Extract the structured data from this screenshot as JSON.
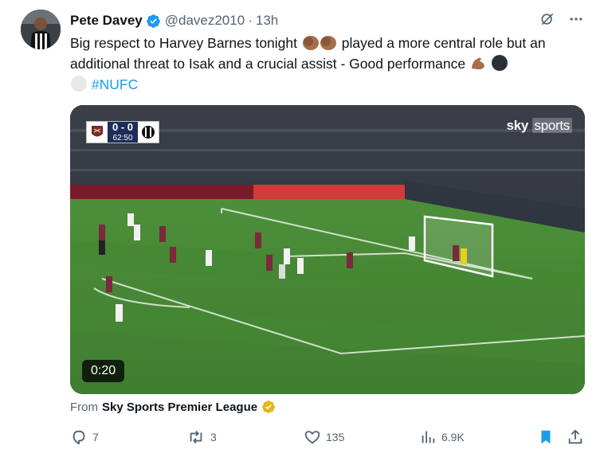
{
  "tweet": {
    "author_name": "Pete Davey",
    "author_handle": "@davez2010",
    "separator": "·",
    "time": "13h",
    "text_main": "Big respect to Harvey Barnes tonight",
    "text_mid": "played a more central role but an additional threat to Isak and a crucial assist - Good performance",
    "hashtag": "#NUFC"
  },
  "media": {
    "timer": "0:20",
    "scoreboard": {
      "score": "0 - 0",
      "clock": "62:50"
    },
    "broadcaster": {
      "word1": "sky",
      "word2": "sports"
    }
  },
  "source": {
    "prefix": "From",
    "name": "Sky Sports Premier League"
  },
  "actions": {
    "replies": "7",
    "reposts": "3",
    "likes": "135",
    "views": "6.9K"
  },
  "colors": {
    "accent": "#1d9bf0",
    "text": "#0f1419",
    "muted": "#536471",
    "bookmark_active": "#1d9bf0"
  },
  "icons": [
    "grok-icon",
    "more-icon",
    "verified-badge-icon",
    "reply-icon",
    "repost-icon",
    "like-icon",
    "views-icon",
    "bookmark-icon",
    "share-icon"
  ]
}
